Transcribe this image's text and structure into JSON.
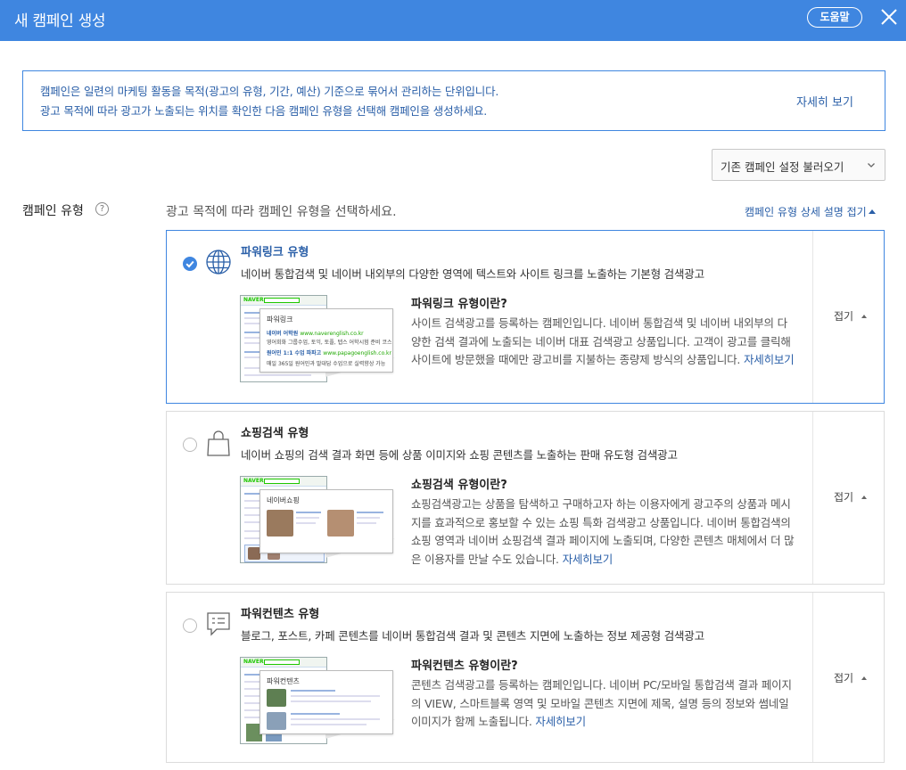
{
  "header": {
    "title": "새 캠페인 생성",
    "help_label": "도움말"
  },
  "notice": {
    "line1": "캠페인은 일련의 마케팅 활동을 목적(광고의 유형, 기간, 예산) 기준으로 묶어서 관리하는 단위입니다.",
    "line2": "광고 목적에 따라 광고가 노출되는 위치를 확인한 다음 캠페인 유형을 선택해 캠페인을 생성하세요.",
    "more_label": "자세히 보기"
  },
  "load_select": {
    "label": "기존 캠페인 설정 불러오기"
  },
  "section": {
    "label": "캠페인 유형",
    "help_glyph": "?",
    "description": "광고 목적에 따라 캠페인 유형을 선택하세요.",
    "collapse_label": "캠페인 유형 상세 설명 접기"
  },
  "cards": [
    {
      "title": "파워링크 유형",
      "summary": "네이버 통합검색 및 네이버 내외부의 다양한 영역에 텍스트와 사이트 링크를 노출하는 기본형 검색광고",
      "detail_title": "파워링크 유형이란?",
      "detail_body": "사이트 검색광고를 등록하는 캠페인입니다. 네이버 통합검색 및 네이버 내외부의 다양한 검색 결과에 노출되는 네이버 대표 검색광고 상품입니다. 고객이 광고를 클릭해 사이트에 방문했을 때에만 광고비를 지불하는 종량제 방식의 상품입니다.",
      "detail_more": "자세히보기",
      "toggle_label": "접기",
      "selected": true,
      "icon": "globe-icon",
      "thumb": {
        "brand": "NAVER",
        "heading": "파워링크",
        "ad1_title": "네이버 어학원",
        "ad1_url": "www.naverenglish.co.kr",
        "ad1_desc": "영어회화 그룹수업, 토익, 토플, 텝스 어학시험 준비 코스",
        "ad2_title": "원어민 1:1 수업 파파고",
        "ad2_url": "www.papagoenglish.co.kr",
        "ad2_desc": "매일 365일 원어민과 말대답 수업으로 실력향상 가능"
      }
    },
    {
      "title": "쇼핑검색 유형",
      "summary": "네이버 쇼핑의 검색 결과 화면 등에 상품 이미지와 쇼핑 콘텐츠를 노출하는 판매 유도형 검색광고",
      "detail_title": "쇼핑검색 유형이란?",
      "detail_body": "쇼핑검색광고는 상품을 탐색하고 구매하고자 하는 이용자에게 광고주의 상품과 메시지를 효과적으로 홍보할 수 있는 쇼핑 특화 검색광고 상품입니다. 네이버 통합검색의 쇼핑 영역과 네이버 쇼핑검색 결과 페이지에 노출되며, 다양한 콘텐츠 매체에서 더 많은 이용자를 만날 수도 있습니다.",
      "detail_more": "자세히보기",
      "toggle_label": "접기",
      "selected": false,
      "icon": "shopping-bag-icon",
      "thumb": {
        "brand": "NAVER",
        "heading": "네이버쇼핑"
      }
    },
    {
      "title": "파워컨텐츠 유형",
      "summary": "블로그, 포스트, 카페 콘텐츠를 네이버 통합검색 결과 및 콘텐츠 지면에 노출하는 정보 제공형 검색광고",
      "detail_title": "파워컨텐츠 유형이란?",
      "detail_body": "콘텐츠 검색광고를 등록하는 캠페인입니다. 네이버 PC/모바일 통합검색 결과 페이지의 VIEW, 스마트블록 영역 및 모바일 콘텐츠 지면에 제목, 설명 등의 정보와 썸네일 이미지가 함께 노출됩니다.",
      "detail_more": "자세히보기",
      "toggle_label": "접기",
      "selected": false,
      "icon": "speech-bubble-icon",
      "thumb": {
        "brand": "NAVER",
        "heading": "파워컨텐츠"
      }
    }
  ],
  "colors": {
    "brand_blue": "#3f86e0",
    "link_blue": "#2a5fa8",
    "naver_green": "#1ec800"
  }
}
